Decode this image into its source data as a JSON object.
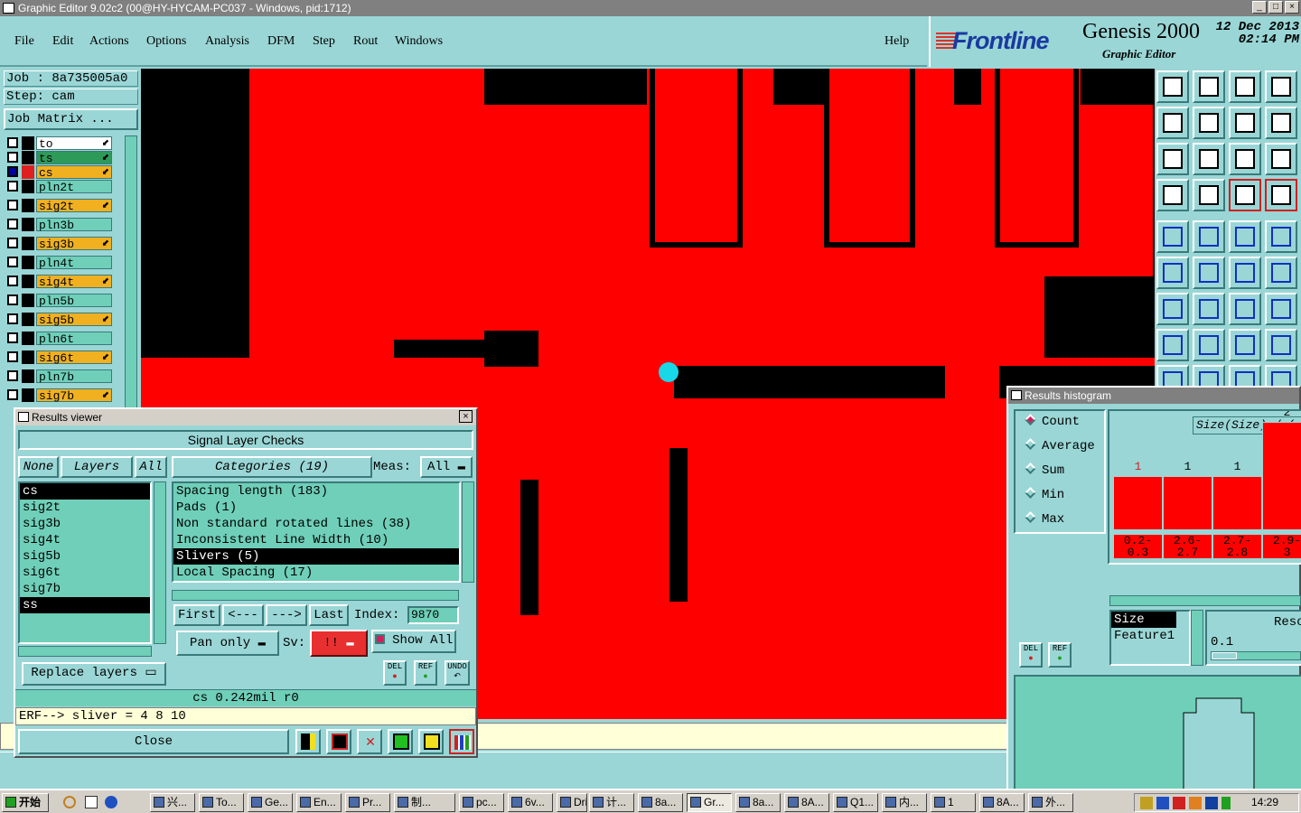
{
  "window": {
    "title": "Graphic Editor 9.02c2 (00@HY-HYCAM-PC037 - Windows, pid:1712)"
  },
  "menu": [
    "File",
    "Edit",
    "Actions",
    "Options",
    "Analysis",
    "DFM",
    "Step",
    "Rout",
    "Windows"
  ],
  "help_label": "Help",
  "brand": {
    "logo": "Frontline",
    "product": "Genesis 2000",
    "subtitle": "Graphic Editor",
    "date": "12 Dec 2013",
    "time": "02:14 PM"
  },
  "job": {
    "job_line": "Job : 8a735005a0",
    "step_line": "Step: cam",
    "matrix_button": "Job Matrix ..."
  },
  "layers": [
    {
      "name": "to",
      "color": "#ffffff",
      "sel": false,
      "arrow": true
    },
    {
      "name": "ts",
      "color": "#2e9a5a",
      "sel": false,
      "arrow": true
    },
    {
      "name": "cs",
      "color": "#f0b020",
      "sel": true,
      "arrow": true
    },
    {
      "name": "pln2t",
      "color": "#6fcfb8",
      "sel": false,
      "arrow": false
    },
    {
      "name": "sig2t",
      "color": "#f0b020",
      "sel": false,
      "arrow": true
    },
    {
      "name": "pln3b",
      "color": "#6fcfb8",
      "sel": false,
      "arrow": false
    },
    {
      "name": "sig3b",
      "color": "#f0b020",
      "sel": false,
      "arrow": true
    },
    {
      "name": "pln4t",
      "color": "#6fcfb8",
      "sel": false,
      "arrow": false
    },
    {
      "name": "sig4t",
      "color": "#f0b020",
      "sel": false,
      "arrow": true
    },
    {
      "name": "pln5b",
      "color": "#6fcfb8",
      "sel": false,
      "arrow": false
    },
    {
      "name": "sig5b",
      "color": "#f0b020",
      "sel": false,
      "arrow": true
    },
    {
      "name": "pln6t",
      "color": "#6fcfb8",
      "sel": false,
      "arrow": false
    },
    {
      "name": "sig6t",
      "color": "#f0b020",
      "sel": false,
      "arrow": true
    },
    {
      "name": "pln7b",
      "color": "#6fcfb8",
      "sel": false,
      "arrow": false
    },
    {
      "name": "sig7b",
      "color": "#f0b020",
      "sel": false,
      "arrow": true
    }
  ],
  "results_viewer": {
    "title": "Results viewer",
    "header": "Signal Layer Checks",
    "none_btn": "None",
    "layers_btn": "Layers",
    "all_btn": "All",
    "categories_btn": "Categories (19)",
    "meas_label": "Meas:",
    "meas_value": "All",
    "layer_list": [
      {
        "t": "cs",
        "hl": true
      },
      {
        "t": "sig2t",
        "hl": false
      },
      {
        "t": "sig3b",
        "hl": false
      },
      {
        "t": "sig4t",
        "hl": false
      },
      {
        "t": "sig5b",
        "hl": false
      },
      {
        "t": "sig6t",
        "hl": false
      },
      {
        "t": "sig7b",
        "hl": false
      },
      {
        "t": "ss",
        "hl": true
      }
    ],
    "categories": [
      {
        "t": "Spacing length (183)",
        "hl": false
      },
      {
        "t": "Pads (1)",
        "hl": false
      },
      {
        "t": "Non standard rotated lines (38)",
        "hl": false
      },
      {
        "t": "Inconsistent Line Width (10)",
        "hl": false
      },
      {
        "t": "Slivers (5)",
        "hl": true
      },
      {
        "t": "Local Spacing (17)",
        "hl": false
      }
    ],
    "first": "First",
    "prev": "<---",
    "next": "--->",
    "last": "Last",
    "index_label": "Index:",
    "index_value": "9870",
    "pan_mode": "Pan only",
    "sv_label": "Sv:",
    "sv_value": "!!",
    "show_all": "Show All",
    "replace_layers": "Replace layers",
    "del": "DEL",
    "ref": "REF",
    "undo": "UNDO",
    "status": "cs 0.242mil  r0",
    "erf": "ERF--> sliver = 4 8 10",
    "close": "Close"
  },
  "histogram": {
    "title": "Results histogram",
    "modes": [
      {
        "t": "Count",
        "on": true
      },
      {
        "t": "Average",
        "on": false
      },
      {
        "t": "Sum",
        "on": false
      },
      {
        "t": "Min",
        "on": false
      },
      {
        "t": "Max",
        "on": false
      }
    ],
    "chart_title": "Size(Size) / (",
    "bars": [
      {
        "count": "1",
        "range": "0.2-\n0.3"
      },
      {
        "count": "1",
        "range": "2.6-\n2.7"
      },
      {
        "count": "1",
        "range": "2.7-\n2.8"
      },
      {
        "count": "2",
        "range": "2.9-\n3"
      }
    ],
    "list": [
      {
        "t": "Size",
        "hl": true
      },
      {
        "t": "Feature1",
        "hl": false
      }
    ],
    "reso_label": "Reso",
    "reso_value": "0.1",
    "del": "DEL",
    "ref": "REF"
  },
  "taskbar": {
    "start": "开始",
    "tasks": [
      "兴...",
      "To...",
      "Ge...",
      "En...",
      "Pr...",
      "制...",
      "pc...",
      "6v...",
      "Dril...",
      "计...",
      "8a...",
      "Gr...",
      "8a...",
      "8A...",
      "Q1...",
      "内...",
      "1",
      "8A...",
      "外..."
    ],
    "clock": "14:29"
  }
}
